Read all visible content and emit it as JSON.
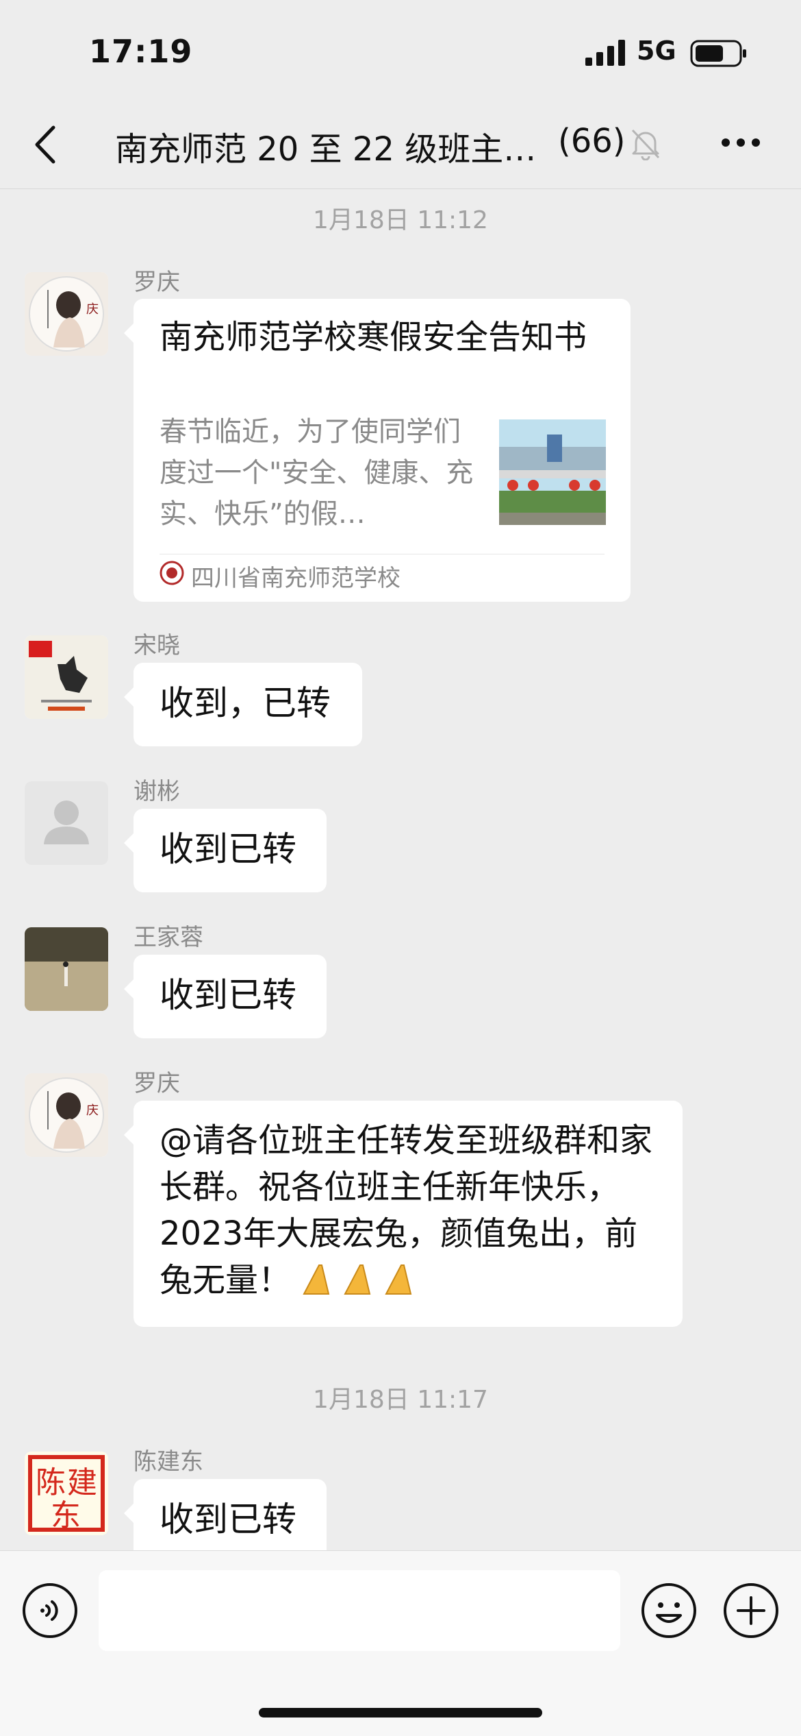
{
  "status_bar": {
    "time": "17:19",
    "network": "5G"
  },
  "header": {
    "title": "南充师范 20 至 22 级班主…",
    "member_count": "(66)"
  },
  "messages": {
    "ts1": "1月18日 11:12",
    "m1": {
      "sender": "罗庆",
      "card": {
        "title": "南充师范学校寒假安全告知书",
        "desc": "春节临近，为了使同学们度过一个\"安全、健康、充实、快乐”的假…",
        "source": "四川省南充师范学校"
      }
    },
    "m2": {
      "sender": "宋晓",
      "text": "收到，已转"
    },
    "m3": {
      "sender": "谢彬",
      "text": "收到已转"
    },
    "m4": {
      "sender": "王家蓉",
      "text": "收到已转"
    },
    "m5": {
      "sender": "罗庆",
      "text": "@请各位班主任转发至班级群和家长群。祝各位班主任新年快乐，2023年大展宏兔，颜值兔出，前兔无量！"
    },
    "ts2": "1月18日 11:17",
    "m6": {
      "sender": "陈建东",
      "text": "收到已转"
    }
  },
  "colors": {
    "background": "#ededed",
    "bubble": "#ffffff",
    "meta_text": "#8a8a8a"
  }
}
